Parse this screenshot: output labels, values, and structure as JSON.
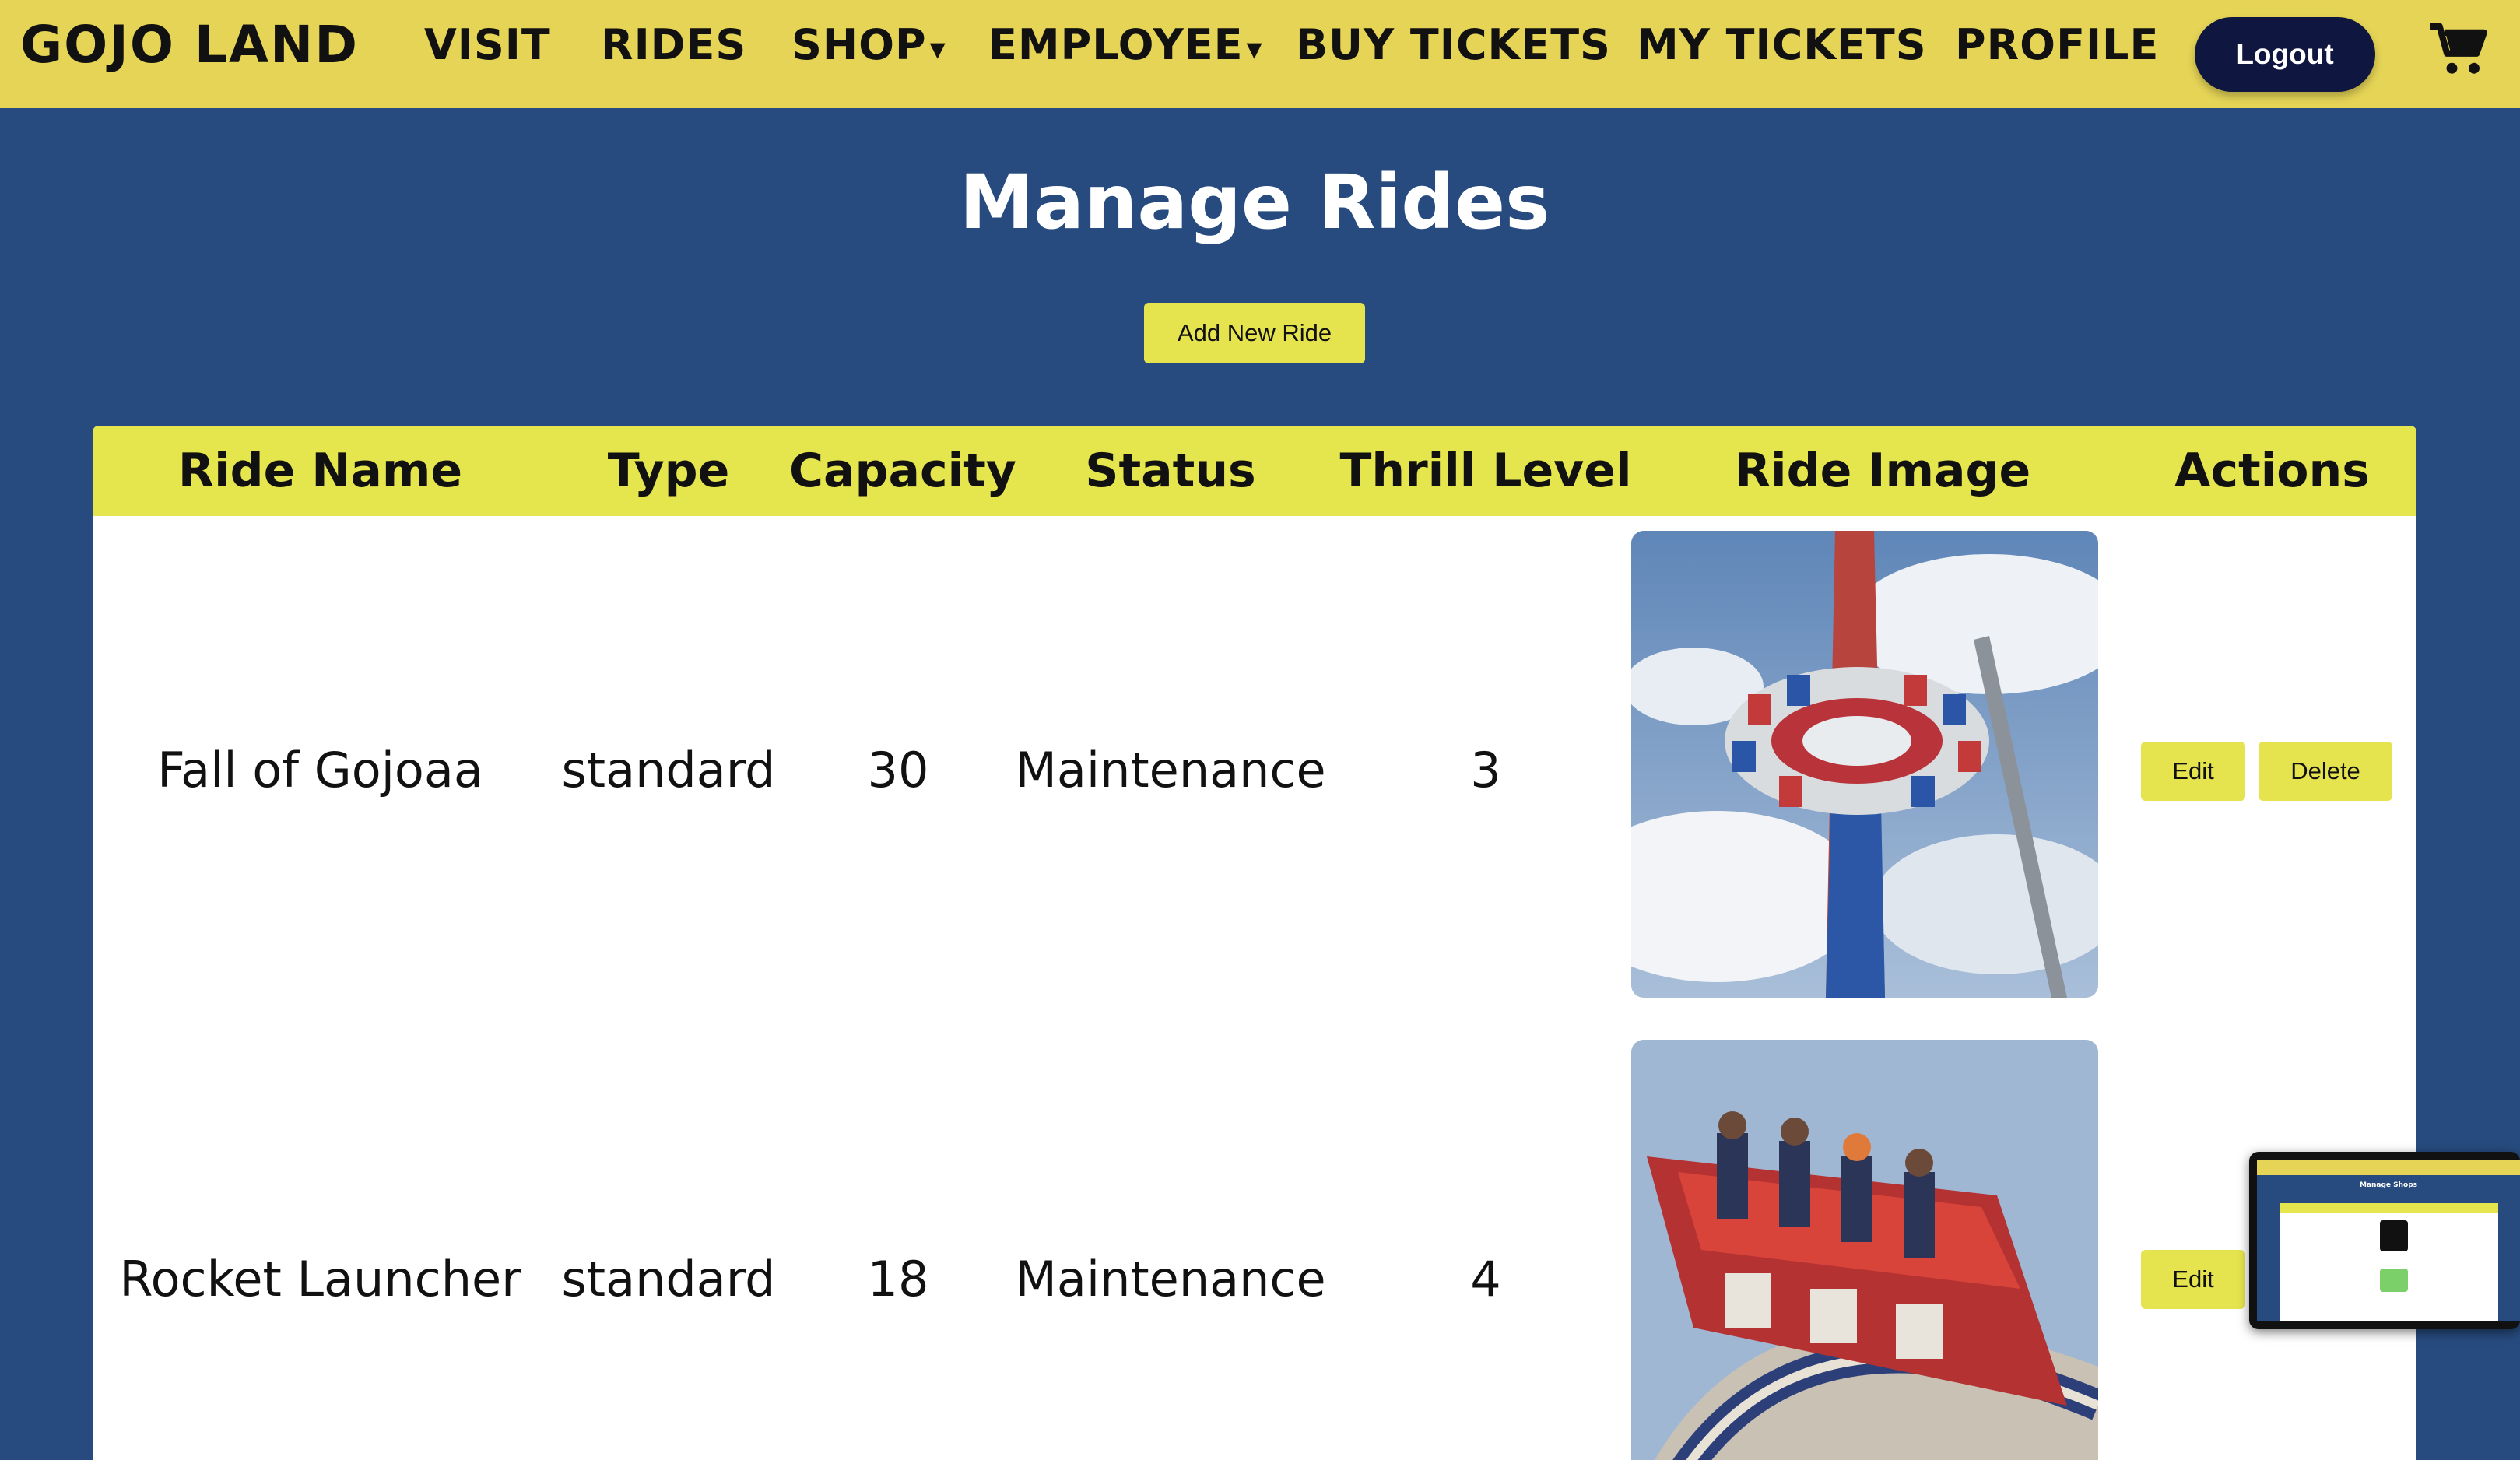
{
  "nav": {
    "brand": "GOJO LAND",
    "links": [
      "VISIT",
      "RIDES",
      "SHOP",
      "EMPLOYEE",
      "BUY TICKETS",
      "MY TICKETS",
      "PROFILE"
    ],
    "caret": "▾",
    "logout_label": "Logout"
  },
  "page": {
    "title": "Manage Rides",
    "add_button_label": "Add New Ride"
  },
  "table": {
    "headers": [
      "Ride Name",
      "Type",
      "Capacity",
      "Status",
      "Thrill Level",
      "Ride Image",
      "Actions"
    ],
    "rows": [
      {
        "name": "Fall of Gojoaa",
        "type": "standard",
        "capacity": "30",
        "status": "Maintenance",
        "thrill": "3",
        "edit_label": "Edit",
        "delete_label": "Delete"
      },
      {
        "name": "Rocket Launcher",
        "type": "standard",
        "capacity": "18",
        "status": "Maintenance",
        "thrill": "4",
        "edit_label": "Edit"
      }
    ]
  },
  "preview": {
    "title": "Manage Shops"
  },
  "colors": {
    "navbar": "#e5d456",
    "background": "#274b7e",
    "accent_button": "#e5e34e",
    "logout": "#0f1640"
  },
  "icons": [
    "cart-icon",
    "caret-down-icon"
  ]
}
